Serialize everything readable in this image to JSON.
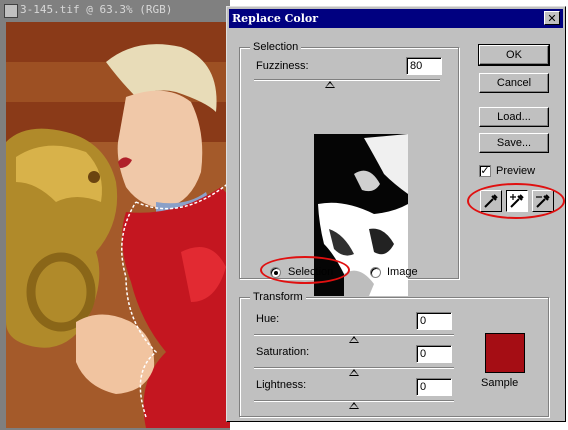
{
  "document": {
    "title": "3-145.tif @ 63.3%  (RGB)"
  },
  "dialog": {
    "title": "Replace Color",
    "close_glyph": "✕",
    "selection_group": {
      "caption": "Selection",
      "fuzziness_label": "Fuzziness:",
      "fuzziness_value": "80",
      "selection_radio_label": "Selection",
      "image_radio_label": "Image",
      "selected_mode": "Selection"
    },
    "buttons": {
      "ok": "OK",
      "cancel": "Cancel",
      "load": "Load...",
      "save": "Save..."
    },
    "preview_label": "Preview",
    "preview_checked": true,
    "eyedroppers": [
      {
        "icon": "eyedropper-icon",
        "active": false
      },
      {
        "icon": "eyedropper-plus-icon",
        "active": true
      },
      {
        "icon": "eyedropper-minus-icon",
        "active": false
      }
    ],
    "transform_group": {
      "caption": "Transform",
      "hue_label": "Hue:",
      "hue_value": "0",
      "saturation_label": "Saturation:",
      "saturation_value": "0",
      "lightness_label": "Lightness:",
      "lightness_value": "0"
    },
    "sample_label": "Sample",
    "sample_color": "#a50d14"
  },
  "annotation_color": "#e01010"
}
